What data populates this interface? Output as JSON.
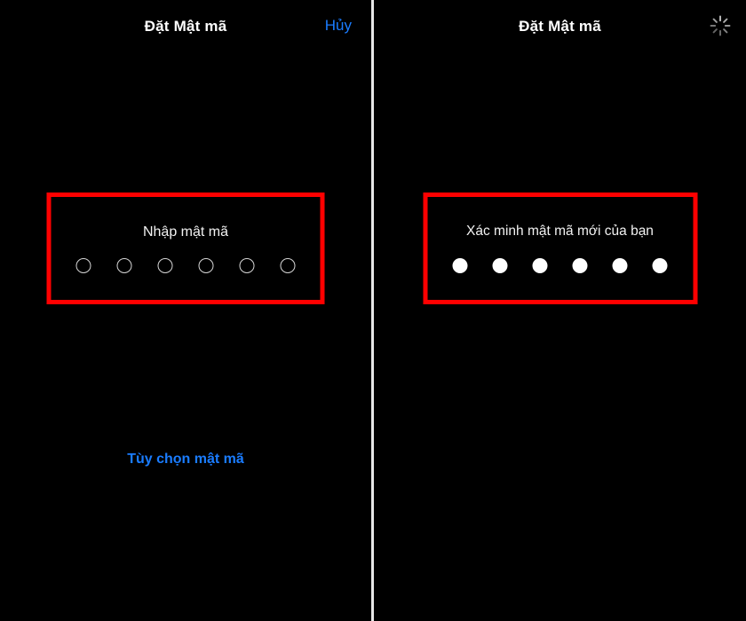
{
  "colors": {
    "background": "#000000",
    "accent_blue": "#1a7cff",
    "highlight_red": "#ff0000",
    "text_primary": "#ffffff",
    "divider": "#e8e8e8"
  },
  "panels": [
    {
      "id": "enter-passcode",
      "navbar": {
        "title": "Đặt Mật mã",
        "action_label": "Hủy",
        "icon": null
      },
      "passcode": {
        "prompt": "Nhập mật mã",
        "dot_count": 6,
        "dots_filled": 0,
        "highlighted": true
      },
      "footer_link": "Tùy chọn mật mã"
    },
    {
      "id": "verify-passcode",
      "navbar": {
        "title": "Đặt Mật mã",
        "action_label": null,
        "icon": "loading-spinner-icon"
      },
      "passcode": {
        "prompt": "Xác minh mật mã mới của bạn",
        "dot_count": 6,
        "dots_filled": 6,
        "highlighted": true
      },
      "footer_link": null
    }
  ]
}
